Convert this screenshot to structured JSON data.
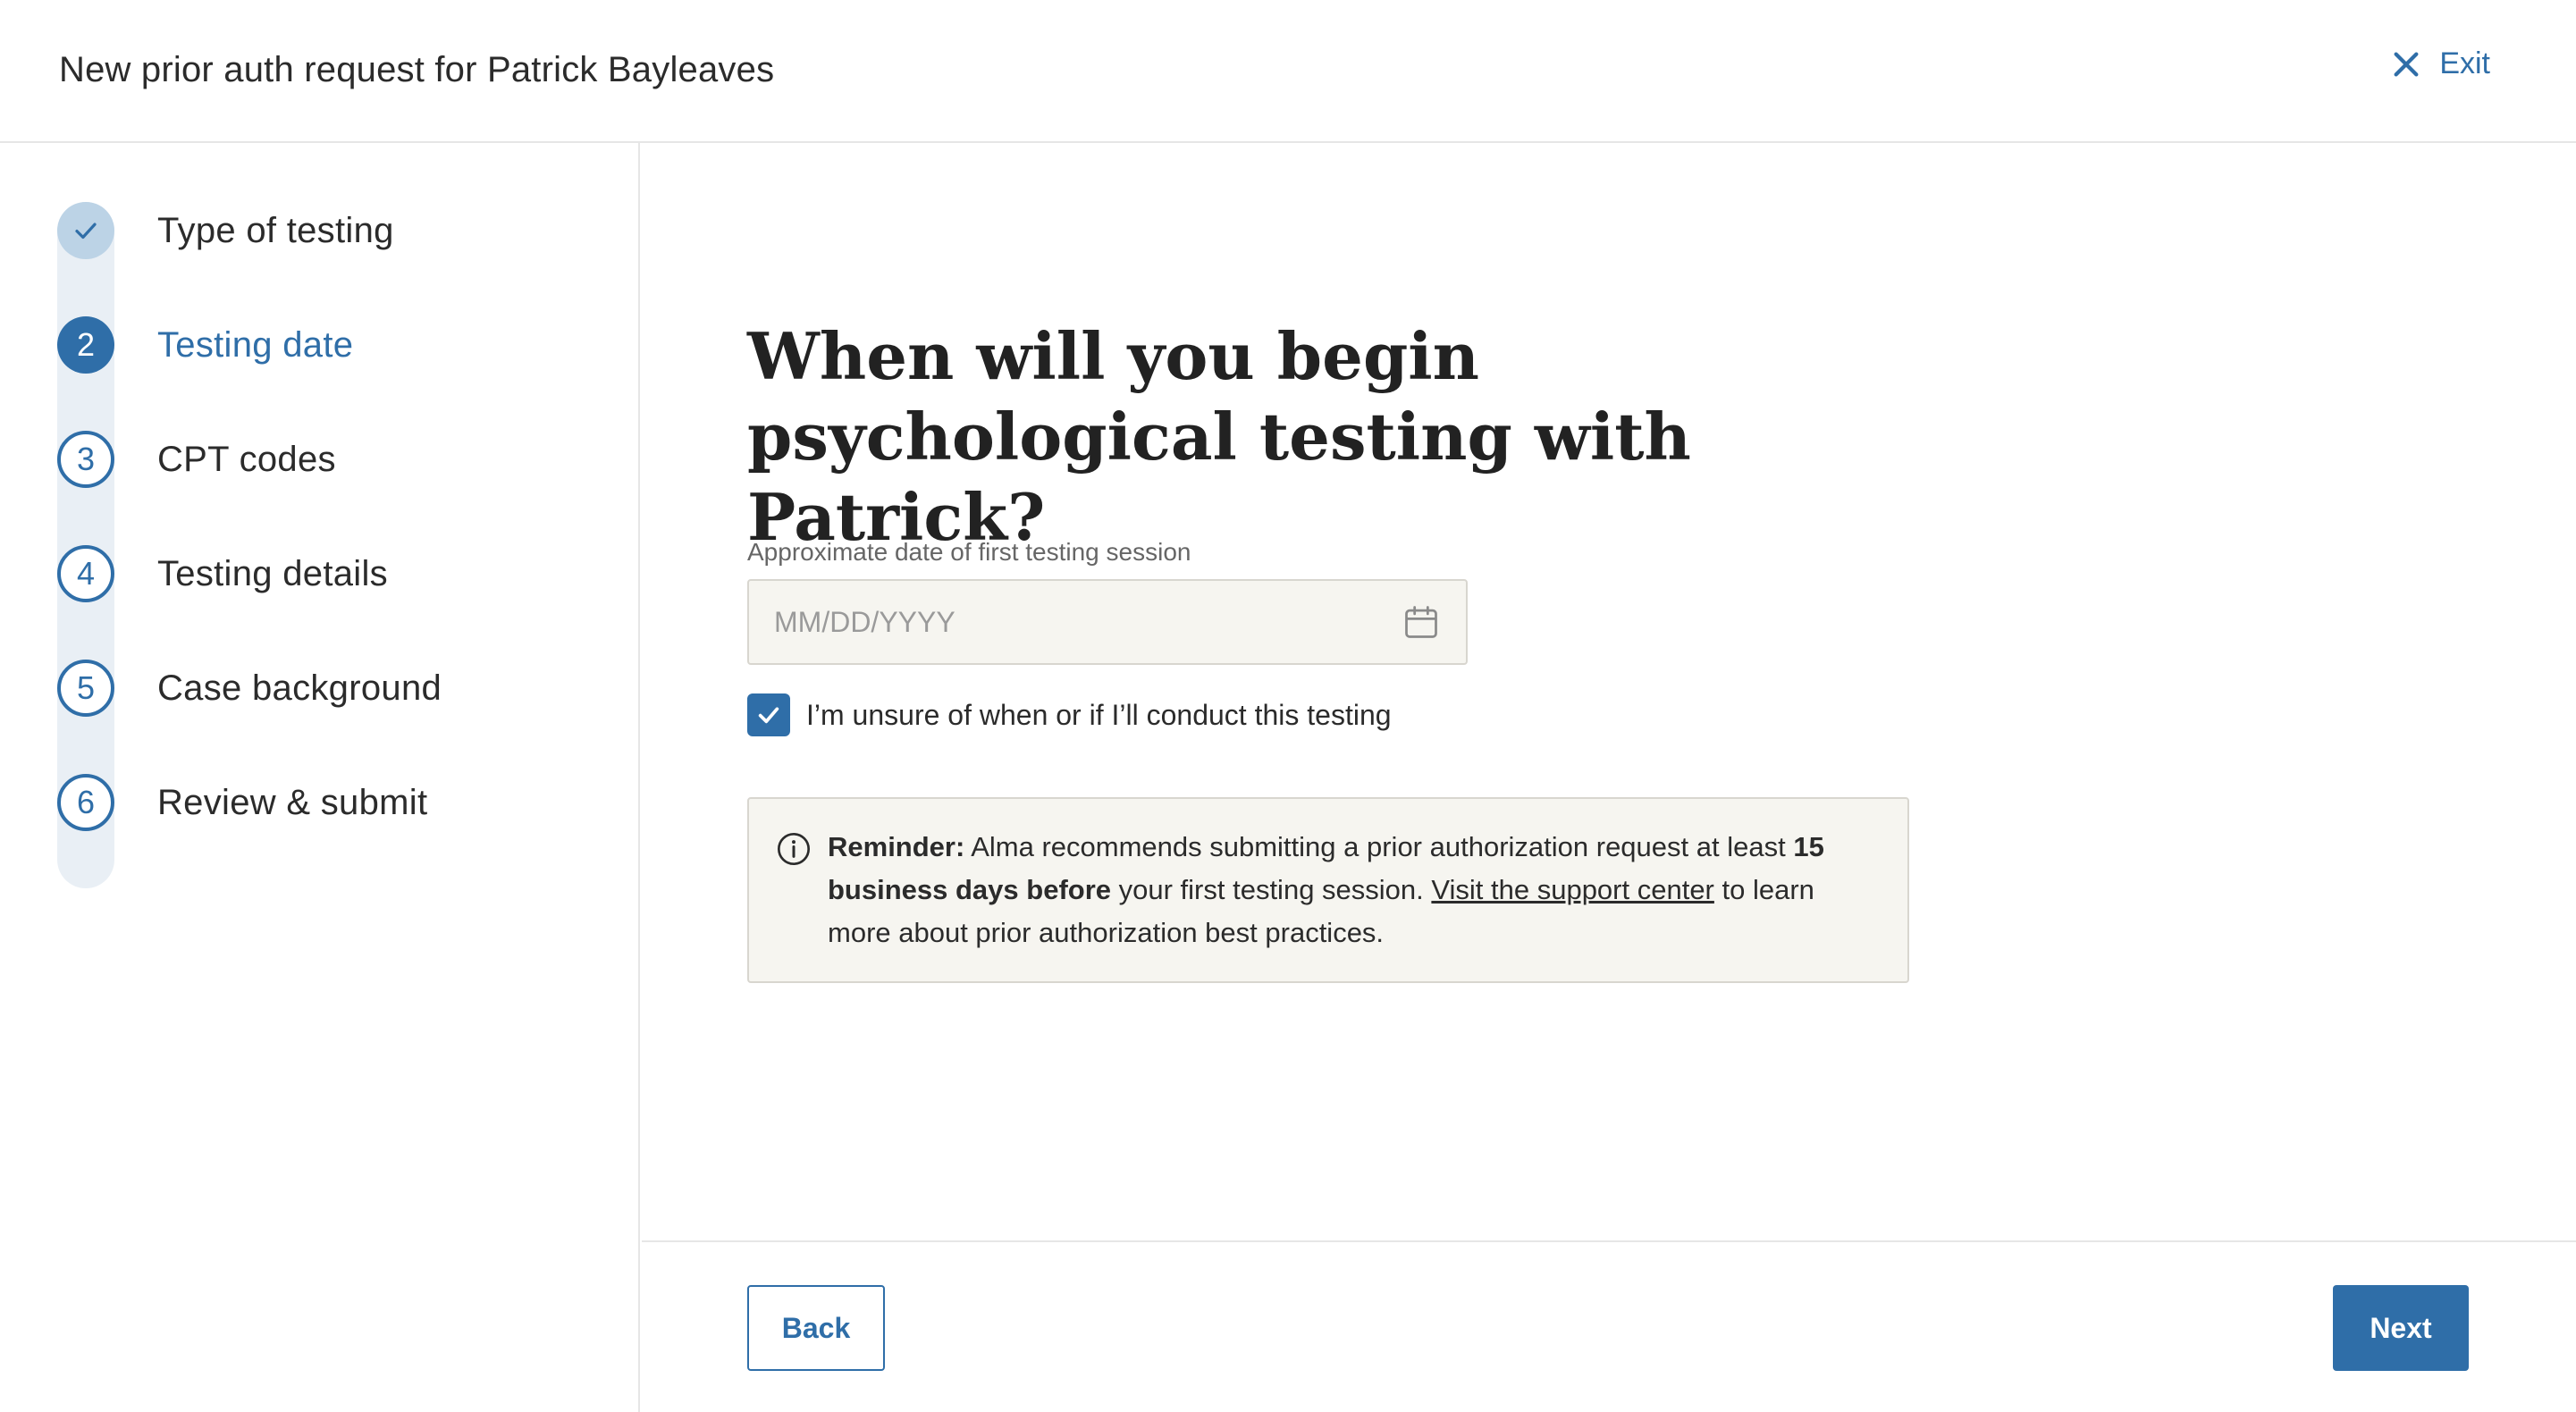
{
  "header": {
    "title": "New prior auth request for Patrick Bayleaves",
    "exit_label": "Exit",
    "exit_icon": "close-icon"
  },
  "colors": {
    "accent": "#2f6ea8",
    "completed_step": "#bcd3e6",
    "panel_bg": "#f6f5f0"
  },
  "steps": [
    {
      "marker": "",
      "label": "Type of testing",
      "status": "completed"
    },
    {
      "marker": "2",
      "label": "Testing date",
      "status": "active"
    },
    {
      "marker": "3",
      "label": "CPT codes",
      "status": "upcoming"
    },
    {
      "marker": "4",
      "label": "Testing details",
      "status": "upcoming"
    },
    {
      "marker": "5",
      "label": "Case background",
      "status": "upcoming"
    },
    {
      "marker": "6",
      "label": "Review & submit",
      "status": "upcoming"
    }
  ],
  "main": {
    "question": "When will you begin psychological testing with Patrick?",
    "date_field": {
      "label": "Approximate date of first testing session",
      "placeholder": "MM/DD/YYYY",
      "value": ""
    },
    "unsure_checkbox": {
      "label": "I’m unsure of when or if I’ll conduct this testing",
      "checked": true
    },
    "reminder": {
      "bold_lead": "Reminder:",
      "text_1": " Alma recommends submitting a prior authorization request at least ",
      "bold_mid": "15 business days before",
      "text_2": " your first testing session. ",
      "link_text": "Visit the support center",
      "text_3": " to learn more about prior authorization best practices."
    }
  },
  "footer": {
    "back_label": "Back",
    "next_label": "Next"
  }
}
